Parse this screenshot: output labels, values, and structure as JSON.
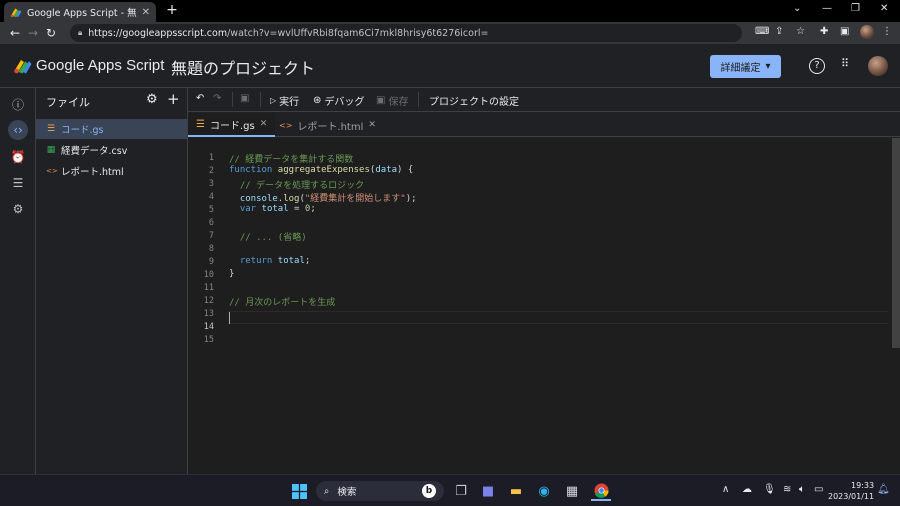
{
  "browser": {
    "tab_title": "Google Apps Script - 無題のプロ",
    "tab_close": "✕",
    "new_tab": "+",
    "url_host": "https://googleappsscript.com",
    "url_path": "/watch?v=wvlUffvRbi8fqam6Ci7mkl8hrisy6t6276icorl=",
    "window_controls": [
      "⌄",
      "—",
      "❐",
      "✕"
    ]
  },
  "app": {
    "brand": "Google Apps Script",
    "project_name": "無題のプロジェクト",
    "deploy_label": "詳細議定",
    "deploy_caret": "▾",
    "help_icon": "?",
    "apps_icon": "⋮⋮"
  },
  "files_panel": {
    "title": "ファイル",
    "files": [
      {
        "name": "コード.gs",
        "icon": "☰",
        "selected": true
      },
      {
        "name": "経費データ.csv",
        "icon": "▦",
        "selected": false
      },
      {
        "name": "レポート.html",
        "icon": "<>",
        "selected": false
      }
    ]
  },
  "toolbar": {
    "run_label": "実行",
    "debug_label": "デバッグ",
    "save_label": "保存",
    "settings_label": "プロジェクトの設定"
  },
  "editor_tabs": [
    {
      "name": "コード.gs",
      "icon": "☰",
      "active": true
    },
    {
      "name": "レポート.html",
      "icon": "<>",
      "active": false
    }
  ],
  "code": {
    "current_line": 14,
    "line_numbers": [
      "1",
      "2",
      "3",
      "4",
      "5",
      "6",
      "7",
      "8",
      "9",
      "10",
      "11",
      "12",
      "13",
      "14",
      "15"
    ],
    "lines": [
      "// 経費データを集計する関数",
      "function aggregateExpenses(data) {",
      "  // データを処理するロジック",
      "  console.log(\"経費集計を開始します\");",
      "  var total = 0;",
      "",
      "  // ... (省略)",
      "",
      "  return total;",
      "}",
      "",
      "// 月次のレポートを生成",
      "",
      ""
    ]
  },
  "taskbar": {
    "search_label": "検索",
    "time": "19:33",
    "date": "2023/01/11"
  }
}
